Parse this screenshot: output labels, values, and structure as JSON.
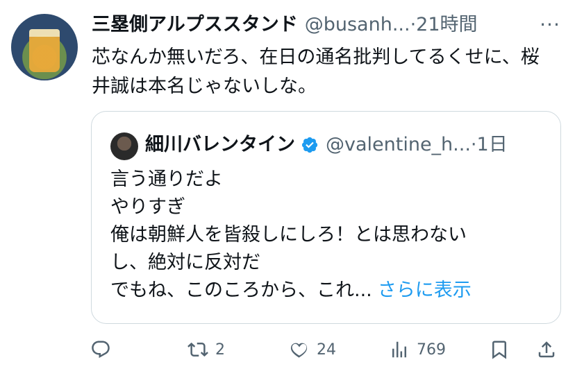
{
  "tweet": {
    "author_name": "三塁側アルプススタンド",
    "handle": "@busanh...",
    "separator": "·",
    "time": "21時間",
    "text": "芯なんか無いだろ、在日の通名批判してるくせに、桜井誠は本名じゃないしな。"
  },
  "quoted": {
    "author_name": "細川バレンタイン",
    "handle": "@valentine_h...",
    "separator": "·",
    "time": "1日",
    "lines": [
      "言う通りだよ",
      "やりすぎ",
      "俺は朝鮮人を皆殺しにしろ！とは思わない",
      "し、絶対に反対だ",
      "でもね、このころから、これ..."
    ],
    "show_more": "さらに表示"
  },
  "actions": {
    "reply": {
      "icon": "reply-icon"
    },
    "retweet": {
      "icon": "retweet-icon",
      "count": "2"
    },
    "like": {
      "icon": "heart-icon",
      "count": "24"
    },
    "views": {
      "icon": "views-icon",
      "count": "769"
    },
    "bookmark": {
      "icon": "bookmark-icon"
    },
    "share": {
      "icon": "share-icon"
    }
  },
  "more_icon": "more-icon",
  "colors": {
    "text": "#0f1419",
    "secondary": "#536471",
    "link": "#1d9bf0",
    "border": "#cfd9de"
  }
}
